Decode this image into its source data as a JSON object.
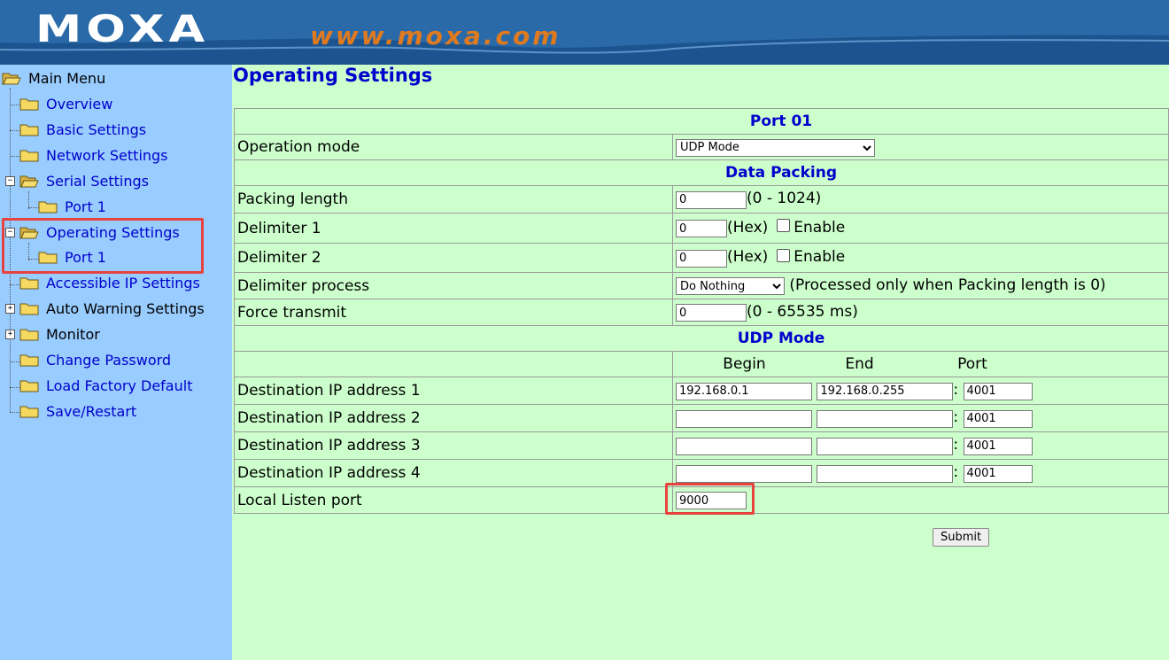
{
  "header": {
    "logo": "MOXA",
    "url": "www.moxa.com"
  },
  "sidebar": {
    "root": "Main Menu",
    "items": [
      {
        "label": "Overview"
      },
      {
        "label": "Basic Settings"
      },
      {
        "label": "Network Settings"
      },
      {
        "label": "Serial Settings"
      },
      {
        "label": "Port 1"
      },
      {
        "label": "Operating Settings"
      },
      {
        "label": "Port 1"
      },
      {
        "label": "Accessible IP Settings"
      },
      {
        "label": "Auto Warning Settings"
      },
      {
        "label": "Monitor"
      },
      {
        "label": "Change Password"
      },
      {
        "label": "Load Factory Default"
      },
      {
        "label": "Save/Restart"
      }
    ]
  },
  "main": {
    "title": "Operating Settings",
    "port_header": "Port 01",
    "operation_mode": {
      "label": "Operation mode",
      "value": "UDP Mode"
    },
    "data_packing_header": "Data Packing",
    "packing_length": {
      "label": "Packing length",
      "value": "0",
      "hint": "(0 - 1024)"
    },
    "delimiter1": {
      "label": "Delimiter 1",
      "value": "0",
      "unit": "(Hex)",
      "enable": "Enable"
    },
    "delimiter2": {
      "label": "Delimiter 2",
      "value": "0",
      "unit": "(Hex)",
      "enable": "Enable"
    },
    "delimiter_process": {
      "label": "Delimiter process",
      "value": "Do Nothing",
      "hint": "(Processed only when Packing length is 0)"
    },
    "force_transmit": {
      "label": "Force transmit",
      "value": "0",
      "hint": "(0 - 65535 ms)"
    },
    "udp_header": "UDP Mode",
    "columns": {
      "begin": "Begin",
      "end": "End",
      "port": "Port"
    },
    "destinations": [
      {
        "label": "Destination IP address 1",
        "begin": "192.168.0.1",
        "end": "192.168.0.255",
        "port": "4001"
      },
      {
        "label": "Destination IP address 2",
        "begin": "",
        "end": "",
        "port": "4001"
      },
      {
        "label": "Destination IP address 3",
        "begin": "",
        "end": "",
        "port": "4001"
      },
      {
        "label": "Destination IP address 4",
        "begin": "",
        "end": "",
        "port": "4001"
      }
    ],
    "local_listen": {
      "label": "Local Listen port",
      "value": "9000"
    },
    "colon": ":",
    "submit": "Submit"
  }
}
